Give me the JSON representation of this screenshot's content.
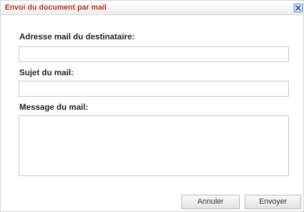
{
  "dialog": {
    "title": "Envoi du document par mail",
    "close_icon": "close-icon"
  },
  "form": {
    "recipient_label": "Adresse mail du destinataire:",
    "recipient_value": "",
    "subject_label": "Sujet du mail:",
    "subject_value": "",
    "message_label": "Message du mail:",
    "message_value": ""
  },
  "buttons": {
    "cancel_label": "Annuler",
    "send_label": "Envoyer"
  },
  "colors": {
    "title": "#b5331d",
    "close_border": "#5d89c9"
  }
}
